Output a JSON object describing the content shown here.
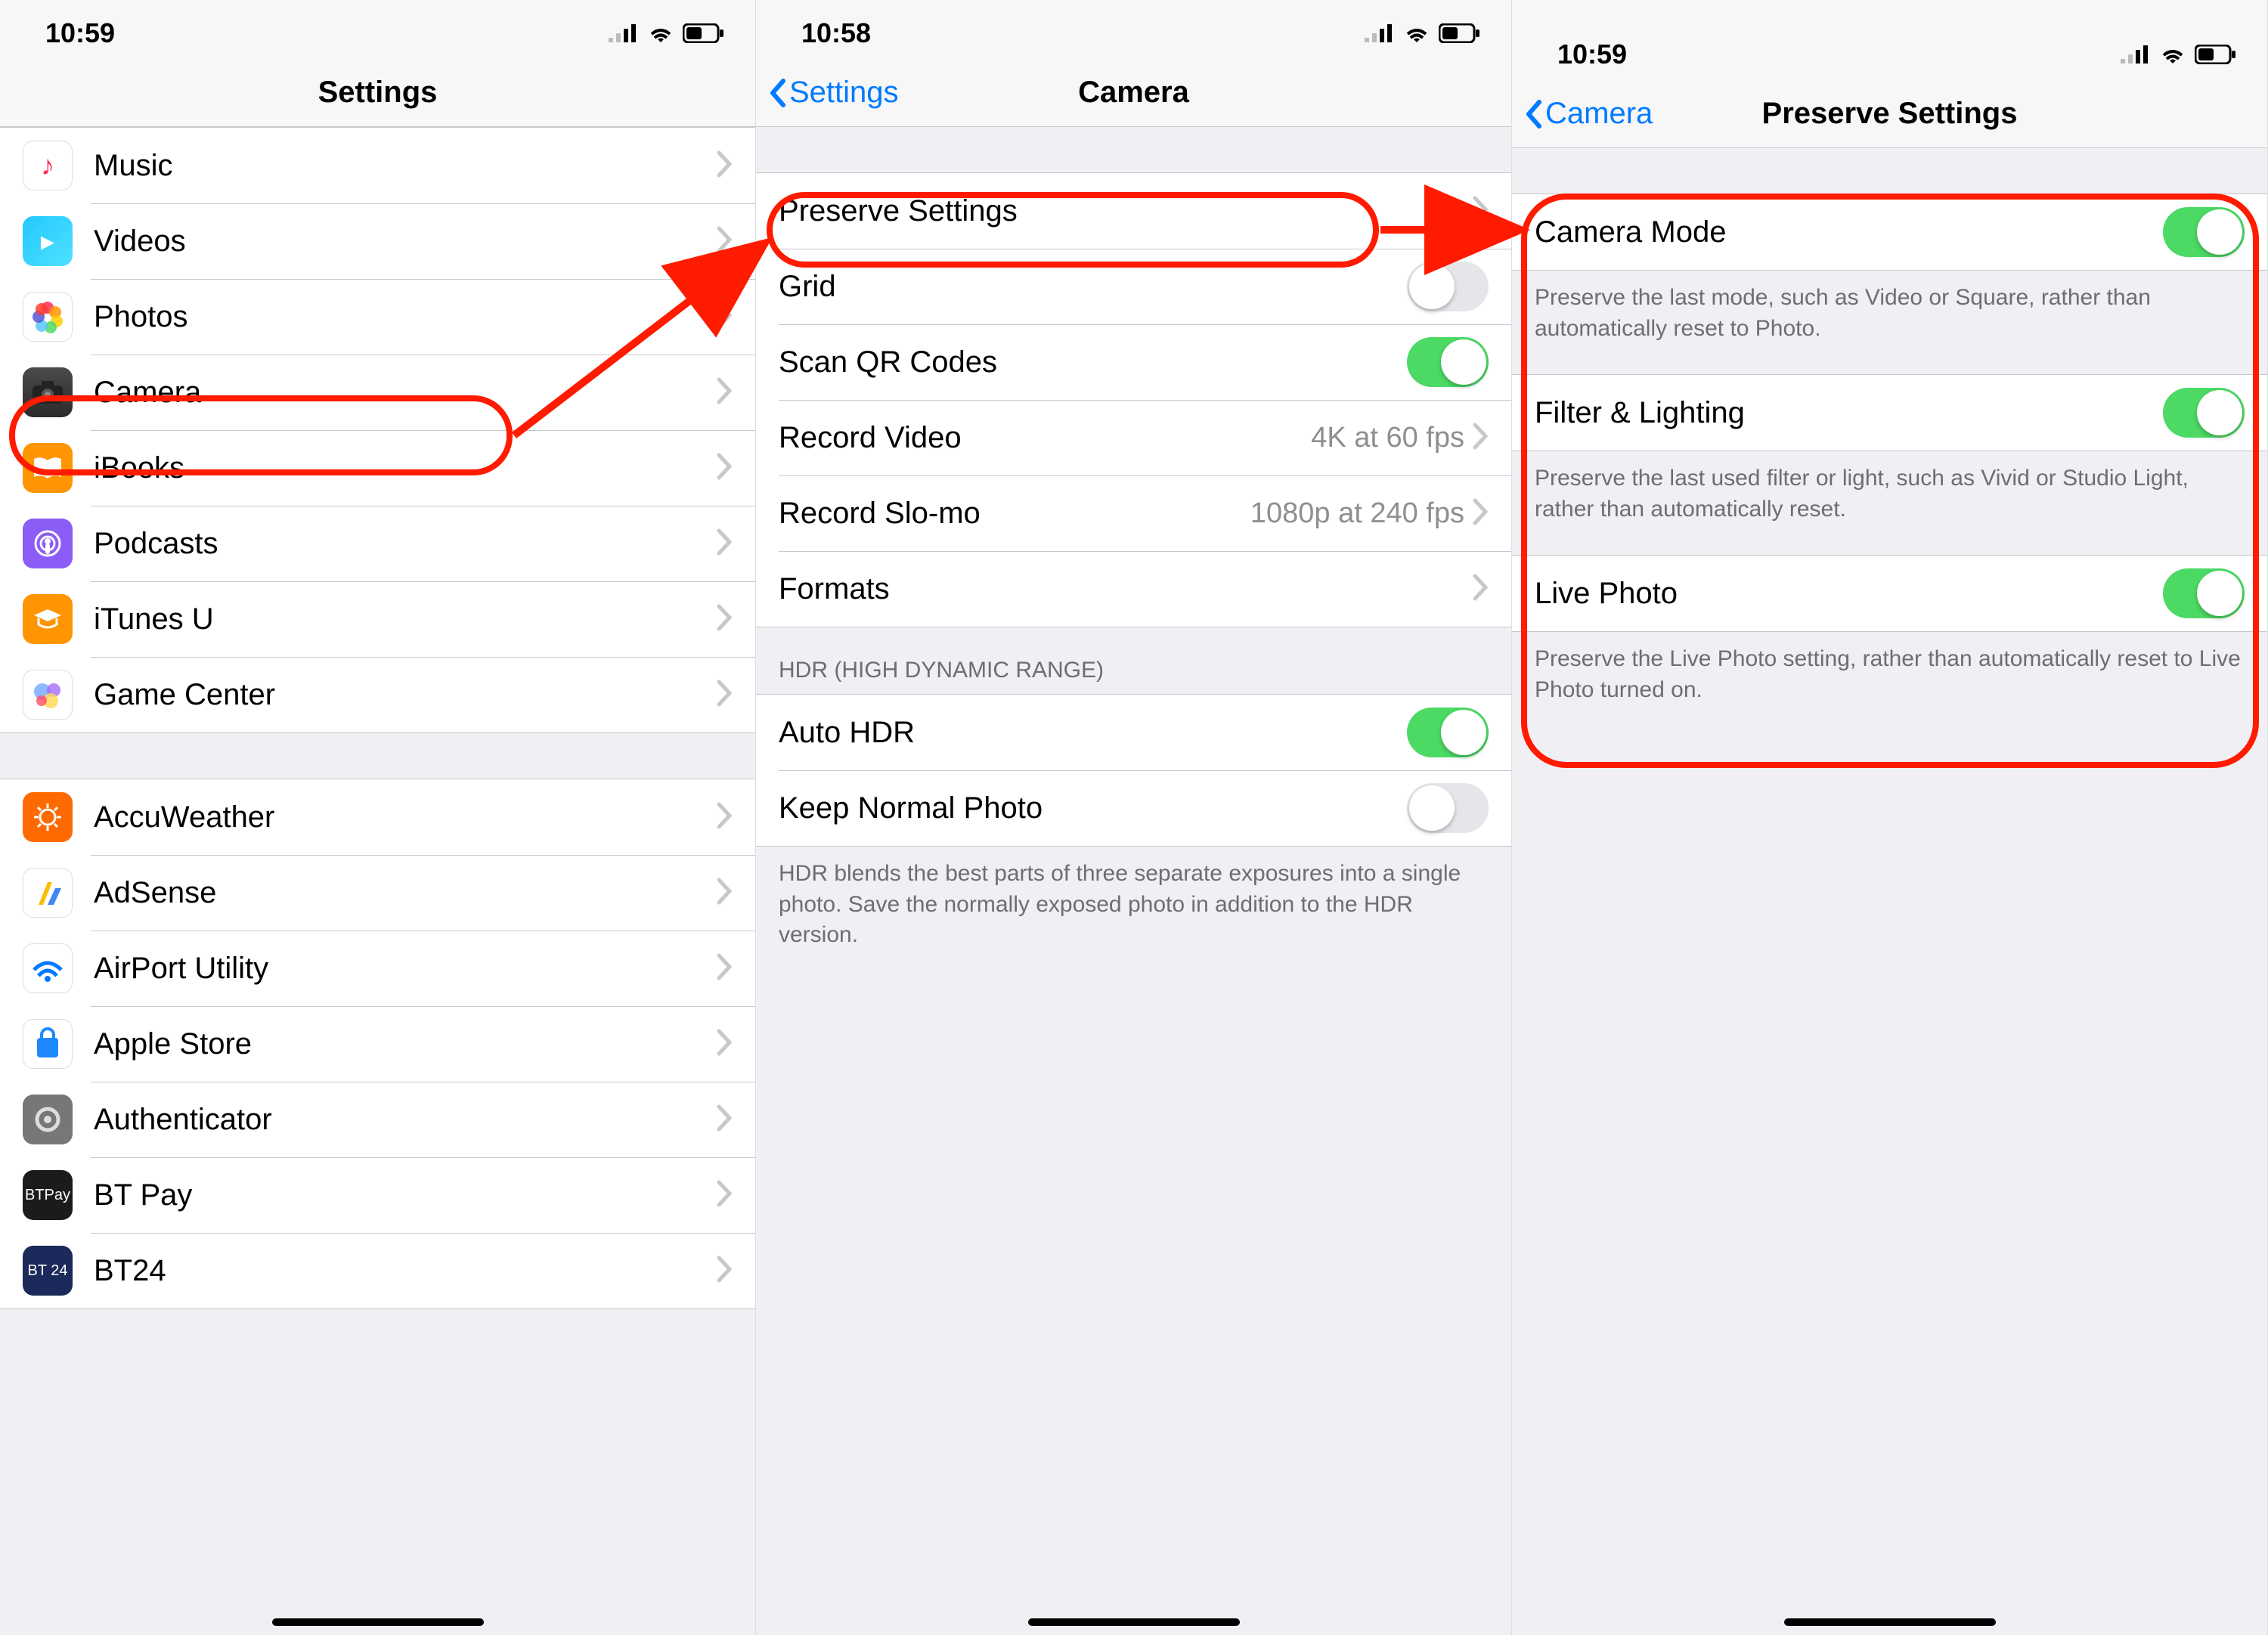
{
  "status": {
    "time_a": "10:59",
    "time_b": "10:58",
    "time_c": "10:59"
  },
  "panel1": {
    "title": "Settings",
    "items": [
      {
        "label": "Music",
        "icon": "music-icon"
      },
      {
        "label": "Videos",
        "icon": "videos-icon"
      },
      {
        "label": "Photos",
        "icon": "photos-icon"
      },
      {
        "label": "Camera",
        "icon": "camera-icon"
      },
      {
        "label": "iBooks",
        "icon": "ibooks-icon"
      },
      {
        "label": "Podcasts",
        "icon": "podcasts-icon"
      },
      {
        "label": "iTunes U",
        "icon": "itunesu-icon"
      },
      {
        "label": "Game Center",
        "icon": "gamecenter-icon"
      }
    ],
    "items2": [
      {
        "label": "AccuWeather",
        "icon": "accuweather-icon"
      },
      {
        "label": "AdSense",
        "icon": "adsense-icon"
      },
      {
        "label": "AirPort Utility",
        "icon": "airport-icon"
      },
      {
        "label": "Apple Store",
        "icon": "applestore-icon"
      },
      {
        "label": "Authenticator",
        "icon": "authenticator-icon"
      },
      {
        "label": "BT Pay",
        "icon": "btpay-icon"
      },
      {
        "label": "BT24",
        "icon": "bt24-icon"
      }
    ]
  },
  "panel2": {
    "back": "Settings",
    "title": "Camera",
    "rows": {
      "preserve": {
        "label": "Preserve Settings"
      },
      "grid": {
        "label": "Grid",
        "toggle": false
      },
      "qr": {
        "label": "Scan QR Codes",
        "toggle": true
      },
      "recvideo": {
        "label": "Record Video",
        "value": "4K at 60 fps"
      },
      "recslomo": {
        "label": "Record Slo-mo",
        "value": "1080p at 240 fps"
      },
      "formats": {
        "label": "Formats"
      }
    },
    "hdr_header": "HDR (HIGH DYNAMIC RANGE)",
    "hdr_rows": {
      "autohdr": {
        "label": "Auto HDR",
        "toggle": true
      },
      "keepnormal": {
        "label": "Keep Normal Photo",
        "toggle": false
      }
    },
    "hdr_footer": "HDR blends the best parts of three separate exposures into a single photo. Save the normally exposed photo in addition to the HDR version."
  },
  "panel3": {
    "back": "Camera",
    "title": "Preserve Settings",
    "rows": {
      "cameramode": {
        "label": "Camera Mode",
        "toggle": true,
        "footer": "Preserve the last mode, such as Video or Square, rather than automatically reset to Photo."
      },
      "filter": {
        "label": "Filter & Lighting",
        "toggle": true,
        "footer": "Preserve the last used filter or light, such as Vivid or Studio Light, rather than automatically reset."
      },
      "livephoto": {
        "label": "Live Photo",
        "toggle": true,
        "footer": "Preserve the Live Photo setting, rather than automatically reset to Live Photo turned on."
      }
    }
  }
}
